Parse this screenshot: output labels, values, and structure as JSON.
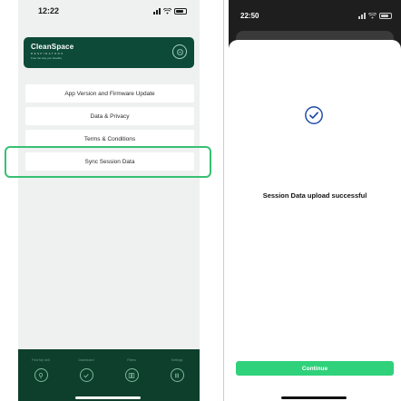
{
  "left_phone": {
    "status": {
      "time": "12:22"
    },
    "brand": {
      "name": "CleanSpace",
      "sub": "RESPIRATORS",
      "tagline": "Free the way you breathe"
    },
    "menu": [
      {
        "label": "App Version and Firmware Update"
      },
      {
        "label": "Data & Privacy"
      },
      {
        "label": "Terms & Conditions"
      },
      {
        "label": "Sync Session Data"
      }
    ],
    "bottom_nav": [
      {
        "label": "Find My Unit",
        "icon": "location-icon"
      },
      {
        "label": "Dashboard",
        "icon": "check-icon"
      },
      {
        "label": "Filters",
        "icon": "filter-icon"
      },
      {
        "label": "Settings",
        "icon": "settings-icon"
      }
    ]
  },
  "right_phone": {
    "status": {
      "time": "22:50"
    },
    "message": "Session Data upload successful",
    "continue_label": "Continue"
  },
  "colors": {
    "brand_dark": "#0d4a37",
    "nav_dark": "#0e3f2c",
    "highlight": "#37c072",
    "continue": "#2fd17a",
    "check": "#1f4aa8"
  }
}
